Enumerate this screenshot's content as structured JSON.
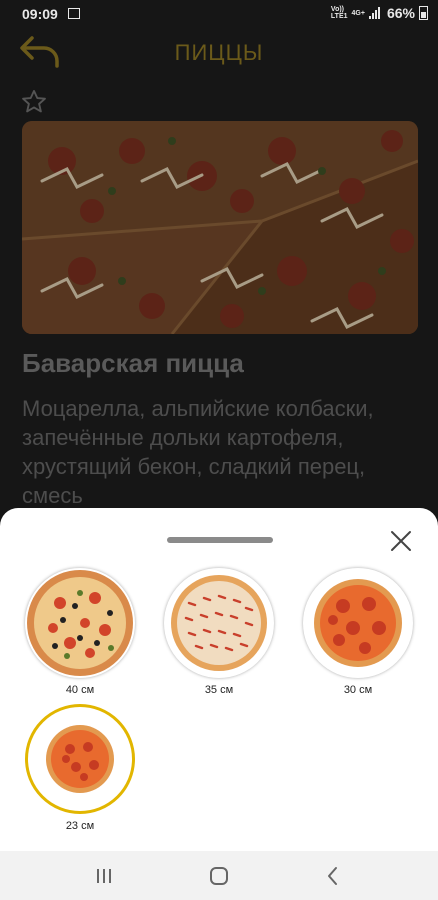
{
  "status_bar": {
    "time": "09:09",
    "network_top": "Vo))",
    "network_bottom": "LTE1",
    "network_type": "4G+",
    "battery": "66%",
    "icons": [
      "gallery-icon",
      "signal-icon",
      "battery-icon"
    ]
  },
  "header": {
    "title": "ПИЦЦЫ",
    "back_icon": "back-arrow-icon",
    "favorite_icon": "star-outline-icon"
  },
  "product": {
    "name": "Баварская пицца",
    "description": "Моцарелла, альпийские колбаски, запечённые дольки картофеля, хрустящий бекон, сладкий перец, смесь"
  },
  "size_sheet": {
    "close_icon": "close-icon",
    "sizes": [
      {
        "label": "40 см",
        "selected": false
      },
      {
        "label": "35 см",
        "selected": false
      },
      {
        "label": "30 см",
        "selected": false
      },
      {
        "label": "23 см",
        "selected": true
      }
    ]
  },
  "nav_bar": {
    "icons": [
      "recent-apps-icon",
      "home-icon",
      "back-icon"
    ]
  },
  "colors": {
    "accent": "#e2b600",
    "title": "#6b5a1a",
    "background": "#161616",
    "sheet": "#ffffff"
  }
}
